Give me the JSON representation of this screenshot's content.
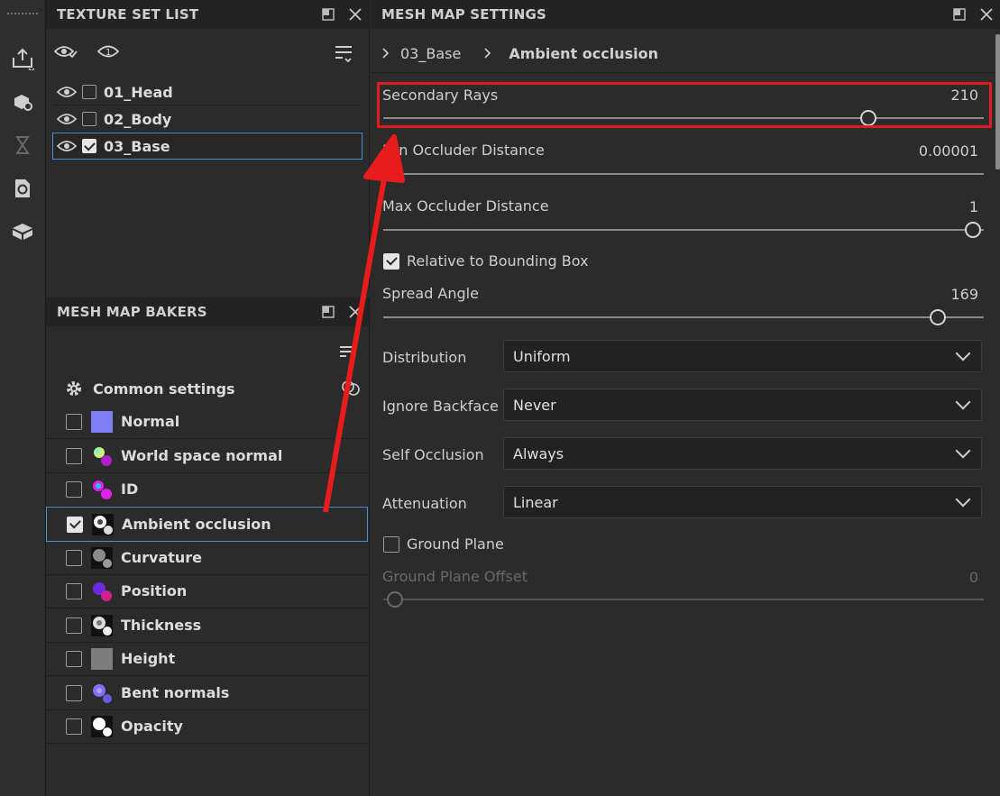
{
  "texture_set_list": {
    "title": "TEXTURE SET LIST",
    "items": [
      {
        "label": "01_Head",
        "checked": false
      },
      {
        "label": "02_Body",
        "checked": false
      },
      {
        "label": "03_Base",
        "checked": true
      }
    ]
  },
  "mesh_map_bakers": {
    "title": "MESH MAP BAKERS",
    "common_settings": "Common settings",
    "items": [
      {
        "label": "Normal",
        "checked": false
      },
      {
        "label": "World space normal",
        "checked": false
      },
      {
        "label": "ID",
        "checked": false
      },
      {
        "label": "Ambient occlusion",
        "checked": true
      },
      {
        "label": "Curvature",
        "checked": false
      },
      {
        "label": "Position",
        "checked": false
      },
      {
        "label": "Thickness",
        "checked": false
      },
      {
        "label": "Height",
        "checked": false
      },
      {
        "label": "Bent normals",
        "checked": false
      },
      {
        "label": "Opacity",
        "checked": false
      }
    ]
  },
  "mesh_map_settings": {
    "title": "MESH MAP SETTINGS",
    "breadcrumb": [
      "03_Base",
      "Ambient occlusion"
    ],
    "secondary_rays": {
      "label": "Secondary Rays",
      "value": "210",
      "fraction": 0.81
    },
    "min_occluder_distance": {
      "label": "Min Occluder Distance",
      "value": "0.00001",
      "fraction": 0.0
    },
    "max_occluder_distance": {
      "label": "Max Occluder Distance",
      "value": "1",
      "fraction": 1.0
    },
    "relative_to_bounding_box": {
      "label": "Relative to Bounding Box",
      "checked": true
    },
    "spread_angle": {
      "label": "Spread Angle",
      "value": "169",
      "fraction": 0.92
    },
    "distribution": {
      "label": "Distribution",
      "value": "Uniform"
    },
    "ignore_backface": {
      "label": "Ignore Backface",
      "value": "Never"
    },
    "self_occlusion": {
      "label": "Self Occlusion",
      "value": "Always"
    },
    "attenuation": {
      "label": "Attenuation",
      "value": "Linear"
    },
    "ground_plane": {
      "label": "Ground Plane",
      "checked": false
    },
    "ground_plane_offset": {
      "label": "Ground Plane Offset",
      "value": "0",
      "fraction": 0.0
    }
  },
  "colors": {
    "highlight": "#e01b1b",
    "selection": "#4a90d9",
    "arrow": "#e81c1c"
  }
}
